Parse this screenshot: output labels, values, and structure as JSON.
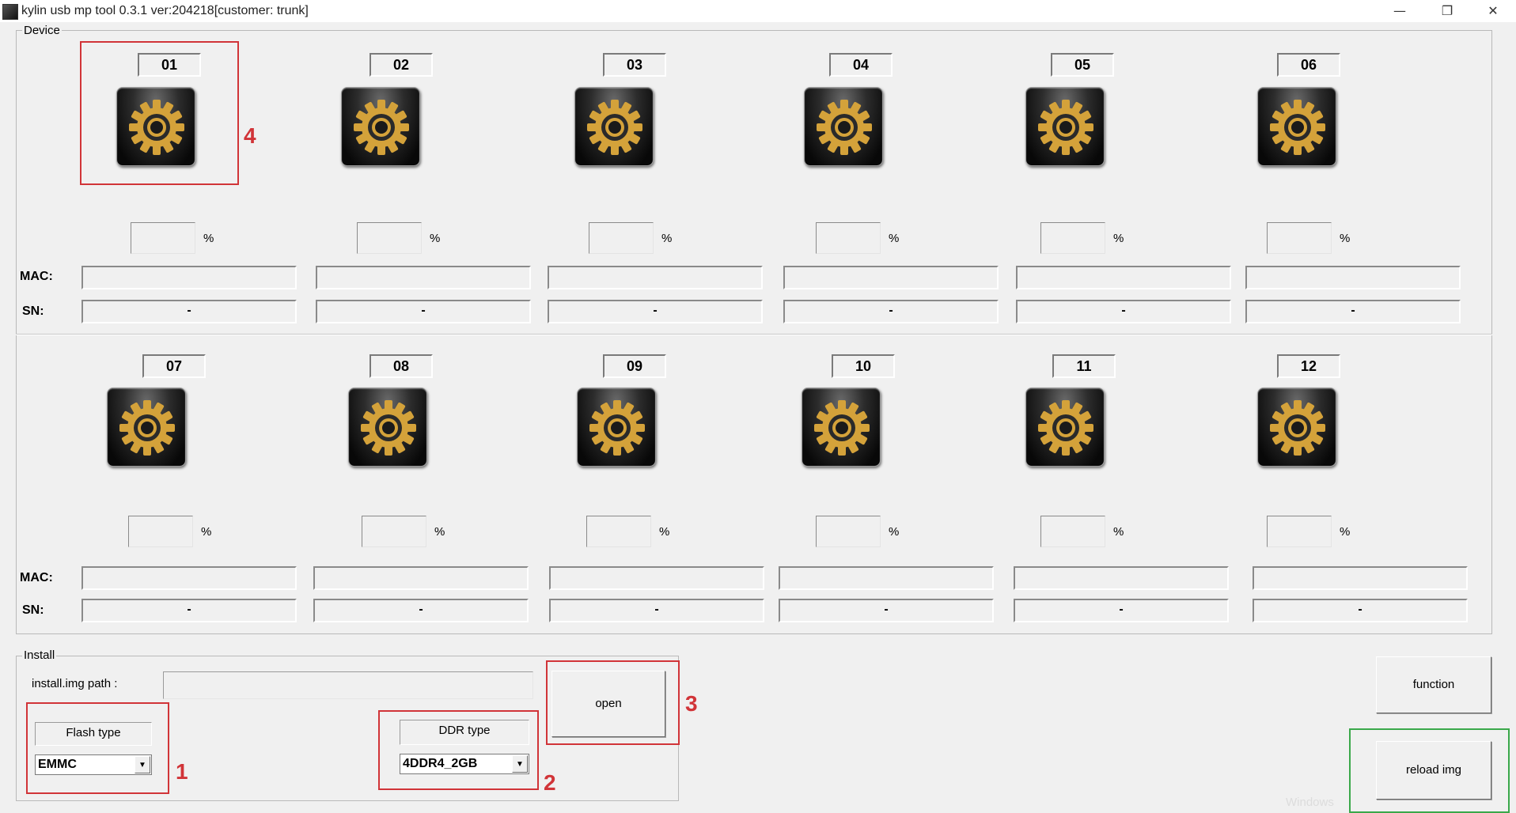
{
  "window": {
    "title": "kylin usb mp tool 0.3.1 ver:204218[customer: trunk]",
    "minimize_glyph": "—",
    "restore_glyph": "❐",
    "close_glyph": "✕"
  },
  "device_group": {
    "legend": "Device",
    "mac_label": "MAC:",
    "sn_label": "SN:",
    "percent_sign": "%",
    "devices": [
      {
        "label": "01",
        "sn": "-",
        "icon": "gear-icon"
      },
      {
        "label": "02",
        "sn": "-",
        "icon": "gear-icon"
      },
      {
        "label": "03",
        "sn": "-",
        "icon": "gear-icon"
      },
      {
        "label": "04",
        "sn": "-",
        "icon": "gear-icon"
      },
      {
        "label": "05",
        "sn": "-",
        "icon": "gear-icon"
      },
      {
        "label": "06",
        "sn": "-",
        "icon": "gear-icon"
      },
      {
        "label": "07",
        "sn": "-",
        "icon": "gear-icon"
      },
      {
        "label": "08",
        "sn": "-",
        "icon": "gear-icon"
      },
      {
        "label": "09",
        "sn": "-",
        "icon": "gear-icon"
      },
      {
        "label": "10",
        "sn": "-",
        "icon": "gear-icon"
      },
      {
        "label": "11",
        "sn": "-",
        "icon": "gear-icon"
      },
      {
        "label": "12",
        "sn": "-",
        "icon": "gear-icon"
      }
    ]
  },
  "install_group": {
    "legend": "Install",
    "img_path_label": "install.img path :",
    "img_path_value": "",
    "flash_type_label": "Flash type",
    "flash_type_value": "EMMC",
    "ddr_type_label": "DDR type",
    "ddr_type_value": "4DDR4_2GB",
    "open_button": "open"
  },
  "function_button": "function",
  "reload_button": "reload img",
  "annotations": [
    "1",
    "2",
    "3",
    "4"
  ],
  "watermark": "Windows",
  "colors": {
    "annotation_red": "#d13438",
    "annotation_green": "#3aa84a",
    "gear_gold": "#d4a23a"
  }
}
